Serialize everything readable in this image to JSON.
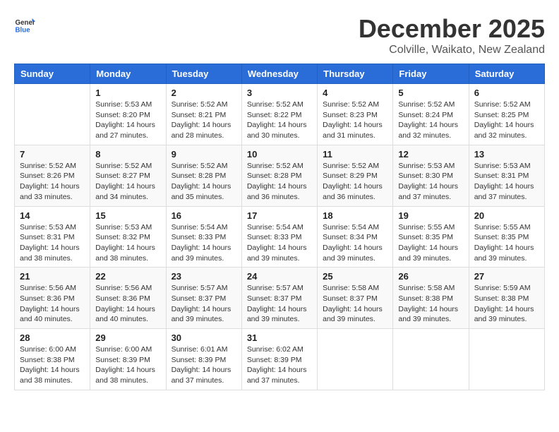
{
  "logo": {
    "general": "General",
    "blue": "Blue"
  },
  "title": "December 2025",
  "subtitle": "Colville, Waikato, New Zealand",
  "weekdays": [
    "Sunday",
    "Monday",
    "Tuesday",
    "Wednesday",
    "Thursday",
    "Friday",
    "Saturday"
  ],
  "weeks": [
    [
      {
        "day": "",
        "info": ""
      },
      {
        "day": "1",
        "info": "Sunrise: 5:53 AM\nSunset: 8:20 PM\nDaylight: 14 hours\nand 27 minutes."
      },
      {
        "day": "2",
        "info": "Sunrise: 5:52 AM\nSunset: 8:21 PM\nDaylight: 14 hours\nand 28 minutes."
      },
      {
        "day": "3",
        "info": "Sunrise: 5:52 AM\nSunset: 8:22 PM\nDaylight: 14 hours\nand 30 minutes."
      },
      {
        "day": "4",
        "info": "Sunrise: 5:52 AM\nSunset: 8:23 PM\nDaylight: 14 hours\nand 31 minutes."
      },
      {
        "day": "5",
        "info": "Sunrise: 5:52 AM\nSunset: 8:24 PM\nDaylight: 14 hours\nand 32 minutes."
      },
      {
        "day": "6",
        "info": "Sunrise: 5:52 AM\nSunset: 8:25 PM\nDaylight: 14 hours\nand 32 minutes."
      }
    ],
    [
      {
        "day": "7",
        "info": "Sunrise: 5:52 AM\nSunset: 8:26 PM\nDaylight: 14 hours\nand 33 minutes."
      },
      {
        "day": "8",
        "info": "Sunrise: 5:52 AM\nSunset: 8:27 PM\nDaylight: 14 hours\nand 34 minutes."
      },
      {
        "day": "9",
        "info": "Sunrise: 5:52 AM\nSunset: 8:28 PM\nDaylight: 14 hours\nand 35 minutes."
      },
      {
        "day": "10",
        "info": "Sunrise: 5:52 AM\nSunset: 8:28 PM\nDaylight: 14 hours\nand 36 minutes."
      },
      {
        "day": "11",
        "info": "Sunrise: 5:52 AM\nSunset: 8:29 PM\nDaylight: 14 hours\nand 36 minutes."
      },
      {
        "day": "12",
        "info": "Sunrise: 5:53 AM\nSunset: 8:30 PM\nDaylight: 14 hours\nand 37 minutes."
      },
      {
        "day": "13",
        "info": "Sunrise: 5:53 AM\nSunset: 8:31 PM\nDaylight: 14 hours\nand 37 minutes."
      }
    ],
    [
      {
        "day": "14",
        "info": "Sunrise: 5:53 AM\nSunset: 8:31 PM\nDaylight: 14 hours\nand 38 minutes."
      },
      {
        "day": "15",
        "info": "Sunrise: 5:53 AM\nSunset: 8:32 PM\nDaylight: 14 hours\nand 38 minutes."
      },
      {
        "day": "16",
        "info": "Sunrise: 5:54 AM\nSunset: 8:33 PM\nDaylight: 14 hours\nand 39 minutes."
      },
      {
        "day": "17",
        "info": "Sunrise: 5:54 AM\nSunset: 8:33 PM\nDaylight: 14 hours\nand 39 minutes."
      },
      {
        "day": "18",
        "info": "Sunrise: 5:54 AM\nSunset: 8:34 PM\nDaylight: 14 hours\nand 39 minutes."
      },
      {
        "day": "19",
        "info": "Sunrise: 5:55 AM\nSunset: 8:35 PM\nDaylight: 14 hours\nand 39 minutes."
      },
      {
        "day": "20",
        "info": "Sunrise: 5:55 AM\nSunset: 8:35 PM\nDaylight: 14 hours\nand 39 minutes."
      }
    ],
    [
      {
        "day": "21",
        "info": "Sunrise: 5:56 AM\nSunset: 8:36 PM\nDaylight: 14 hours\nand 40 minutes."
      },
      {
        "day": "22",
        "info": "Sunrise: 5:56 AM\nSunset: 8:36 PM\nDaylight: 14 hours\nand 40 minutes."
      },
      {
        "day": "23",
        "info": "Sunrise: 5:57 AM\nSunset: 8:37 PM\nDaylight: 14 hours\nand 39 minutes."
      },
      {
        "day": "24",
        "info": "Sunrise: 5:57 AM\nSunset: 8:37 PM\nDaylight: 14 hours\nand 39 minutes."
      },
      {
        "day": "25",
        "info": "Sunrise: 5:58 AM\nSunset: 8:37 PM\nDaylight: 14 hours\nand 39 minutes."
      },
      {
        "day": "26",
        "info": "Sunrise: 5:58 AM\nSunset: 8:38 PM\nDaylight: 14 hours\nand 39 minutes."
      },
      {
        "day": "27",
        "info": "Sunrise: 5:59 AM\nSunset: 8:38 PM\nDaylight: 14 hours\nand 39 minutes."
      }
    ],
    [
      {
        "day": "28",
        "info": "Sunrise: 6:00 AM\nSunset: 8:38 PM\nDaylight: 14 hours\nand 38 minutes."
      },
      {
        "day": "29",
        "info": "Sunrise: 6:00 AM\nSunset: 8:39 PM\nDaylight: 14 hours\nand 38 minutes."
      },
      {
        "day": "30",
        "info": "Sunrise: 6:01 AM\nSunset: 8:39 PM\nDaylight: 14 hours\nand 37 minutes."
      },
      {
        "day": "31",
        "info": "Sunrise: 6:02 AM\nSunset: 8:39 PM\nDaylight: 14 hours\nand 37 minutes."
      },
      {
        "day": "",
        "info": ""
      },
      {
        "day": "",
        "info": ""
      },
      {
        "day": "",
        "info": ""
      }
    ]
  ]
}
